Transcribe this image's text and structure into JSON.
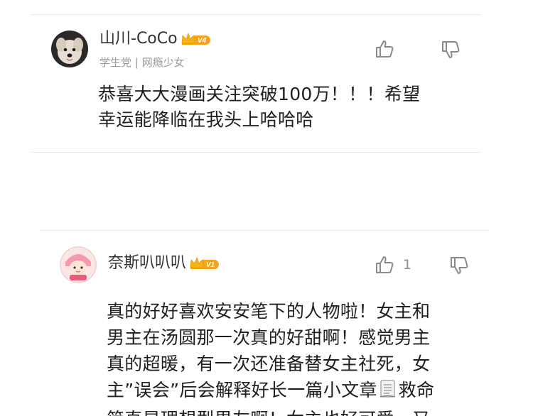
{
  "colors": {
    "divider": "#e8e8e8",
    "icon_gray": "#8a8a8a",
    "badge_gold": "#f5b21b",
    "badge_orange": "#f7a21b",
    "text_main": "#1f1f1f",
    "text_sub": "#9a9a9a"
  },
  "comments": [
    {
      "username": "山川-CoCo",
      "badge_icon": "crown-icon",
      "level": "V4",
      "subtitle": "学生党 | 网瘾少女",
      "lines": [
        "恭喜大大漫画关注突破100万！！！希望",
        "幸运能降临在我头上哈哈哈"
      ],
      "like_icon": "thumbs-up-icon",
      "dislike_icon": "thumbs-down-icon",
      "like_count": ""
    },
    {
      "username": "奈斯叭叭叭",
      "badge_icon": "crown-icon",
      "level": "V1",
      "lines": [
        "真的好好喜欢安安笔下的人物啦！女主和",
        "男主在汤圆那一次真的好甜啊！感觉男主",
        "真的超暖，有一次还准备替女主社死，女",
        "主”误会”后会解释好长一篇小文章",
        "救命",
        "简直是理想型男友啊！女主也好可爱，又"
      ],
      "inline_icon": "scroll-document-icon",
      "like_icon": "thumbs-up-icon",
      "dislike_icon": "thumbs-down-icon",
      "like_count": "1"
    }
  ]
}
